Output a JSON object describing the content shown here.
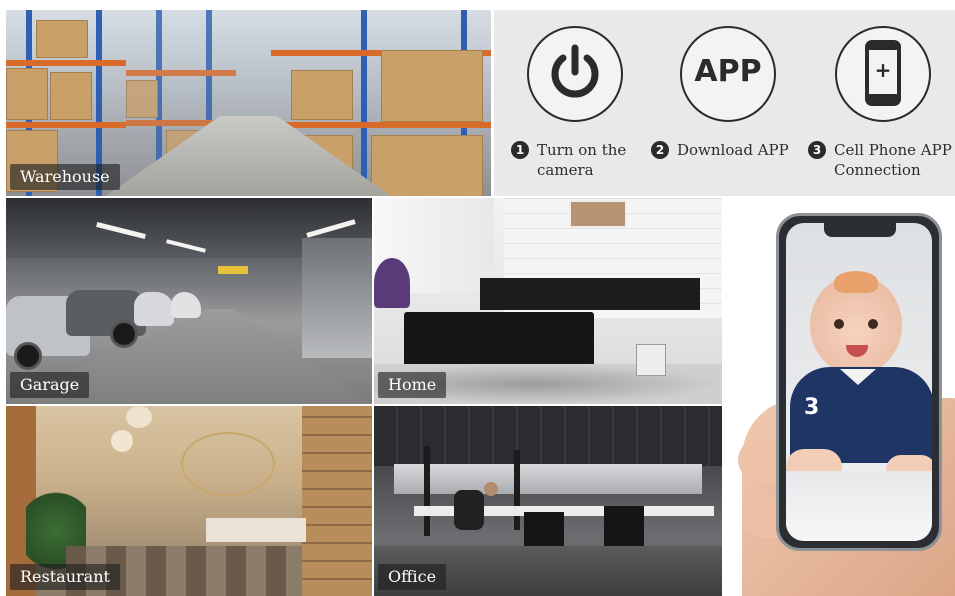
{
  "scenes": {
    "warehouse": "Warehouse",
    "garage": "Garage",
    "home": "Home",
    "restaurant": "Restaurant",
    "office": "Office"
  },
  "steps": [
    {
      "number": "1",
      "line1": "Turn on the",
      "line2": "camera",
      "icon": "power-icon"
    },
    {
      "number": "2",
      "line1": "Download APP",
      "line2": "",
      "icon": "app-icon",
      "icon_text": "APP"
    },
    {
      "number": "3",
      "line1": "Cell Phone APP",
      "line2": "Connection",
      "icon": "smartphone-icon",
      "icon_symbol": "+"
    }
  ],
  "baby_shirt_number": "3",
  "colors": {
    "rack_beam": "#d86a2a",
    "rack_post": "#2e5fb0",
    "icon_stroke": "#2b2b2b"
  }
}
